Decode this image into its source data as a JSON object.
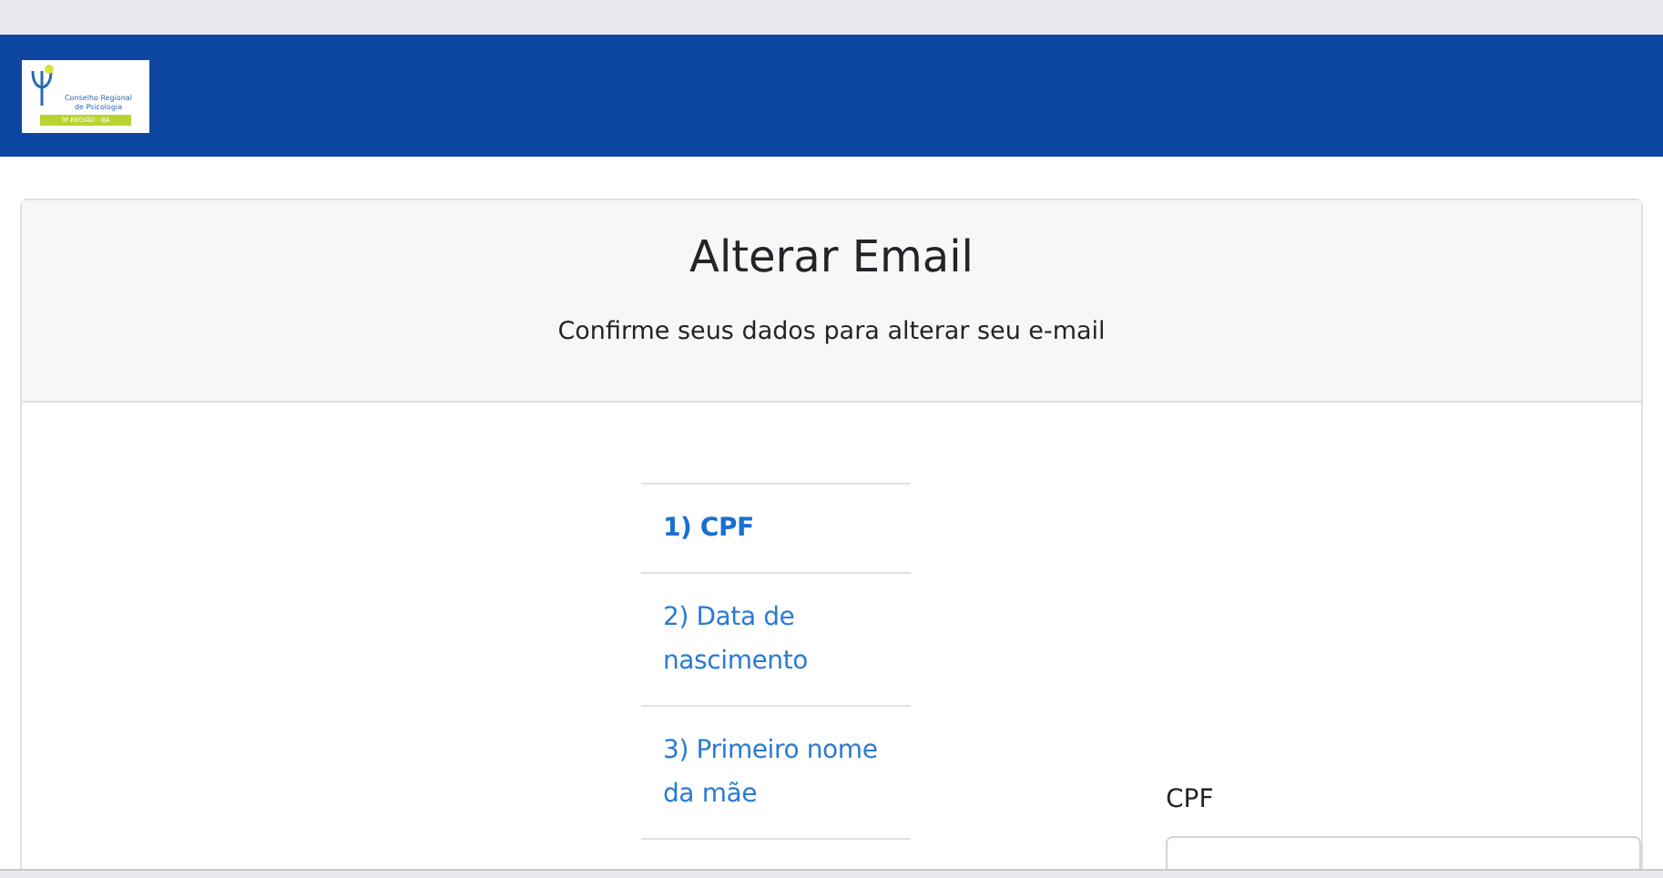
{
  "header": {
    "logo": {
      "name": "Conselho Regional de Psicologia",
      "region": "3ª REGIÃO · BA"
    }
  },
  "card": {
    "title": "Alterar Email",
    "subtitle": "Confirme seus dados para alterar seu e-mail"
  },
  "steps": [
    {
      "label": "1) CPF",
      "selected": true
    },
    {
      "label": "2) Data de nascimento",
      "selected": false
    },
    {
      "label": "3) Primeiro nome da mãe",
      "selected": false
    }
  ],
  "field": {
    "label": "CPF"
  }
}
